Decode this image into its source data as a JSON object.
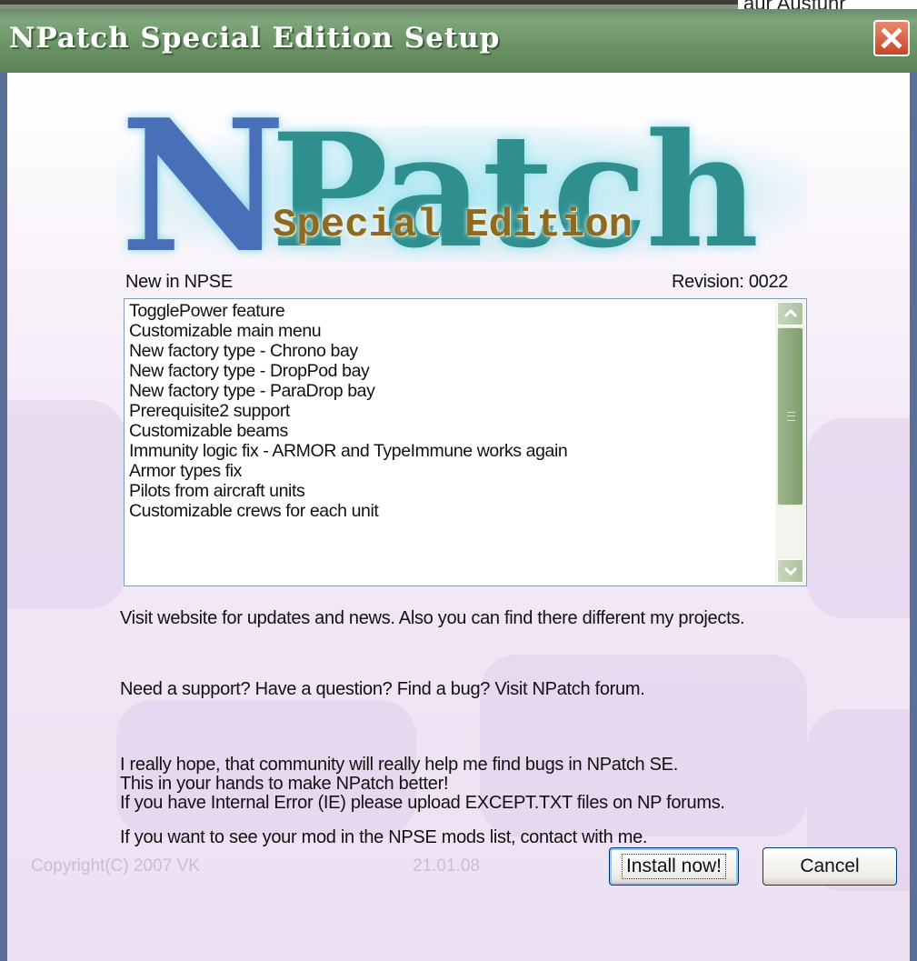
{
  "top_corner_text": "aur Ausführ",
  "window": {
    "title": "NPatch Special Edition Setup"
  },
  "logo": {
    "letter_n": "N",
    "word_patch": "Patch",
    "subtitle": "Special Edition"
  },
  "changes": {
    "heading": "New in NPSE",
    "revision": "Revision: 0022",
    "items": [
      "TogglePower feature",
      "Customizable main menu",
      "New factory type - Chrono bay",
      "New factory type - DropPod bay",
      "New factory type - ParaDrop bay",
      "Prerequisite2 support",
      "Customizable beams",
      "Immunity logic fix - ARMOR and TypeImmune works again",
      "Armor types fix",
      "Pilots from aircraft units",
      "Customizable crews for each unit"
    ]
  },
  "info": {
    "website": "Visit website for updates and news. Also you can find there different my projects.",
    "support": "Need a support? Have a question? Find a bug? Visit NPatch forum.",
    "hope_line1": "I really hope, that community will really help me find bugs in NPatch SE.",
    "hope_line2": "This in your hands to make NPatch better!",
    "hope_line3": "If you have Internal Error (IE) please upload EXCEPT.TXT files on NP forums.",
    "mods": "If you want to see your mod in the NPSE mods list, contact with me."
  },
  "footer": {
    "copyright": "Copyright(C) 2007 VK",
    "date": "21.01.08",
    "install_label": "Install now!",
    "cancel_label": "Cancel"
  },
  "colors": {
    "titlebar": "#6c9567",
    "client_background": "#ece0f3",
    "logo_n": "#4a6fb9",
    "logo_patch": "#2f8f8f"
  }
}
